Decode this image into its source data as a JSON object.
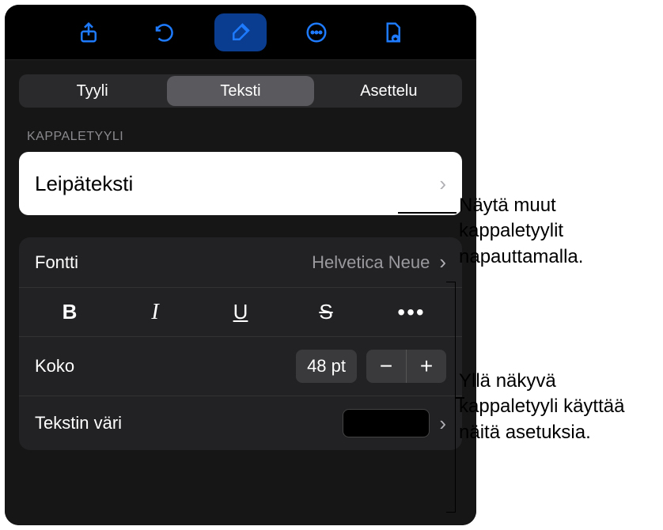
{
  "toolbar": {
    "share": "share-icon",
    "undo": "undo-icon",
    "format": "brush-icon",
    "more": "more-icon",
    "view": "view-icon"
  },
  "tabs": {
    "style": "Tyyli",
    "text": "Teksti",
    "layout": "Asettelu"
  },
  "section": {
    "paragraph_style": "KAPPALETYYLI"
  },
  "paragraph_style": {
    "name": "Leipäteksti"
  },
  "font": {
    "label": "Fontti",
    "value": "Helvetica Neue"
  },
  "size": {
    "label": "Koko",
    "value": "48 pt"
  },
  "color": {
    "label": "Tekstin väri",
    "value_hex": "#000000"
  },
  "callouts": {
    "c1": "Näytä muut kappaletyylit napauttamalla.",
    "c2": "Yllä näkyvä kappaletyyli käyttää näitä asetuksia."
  }
}
